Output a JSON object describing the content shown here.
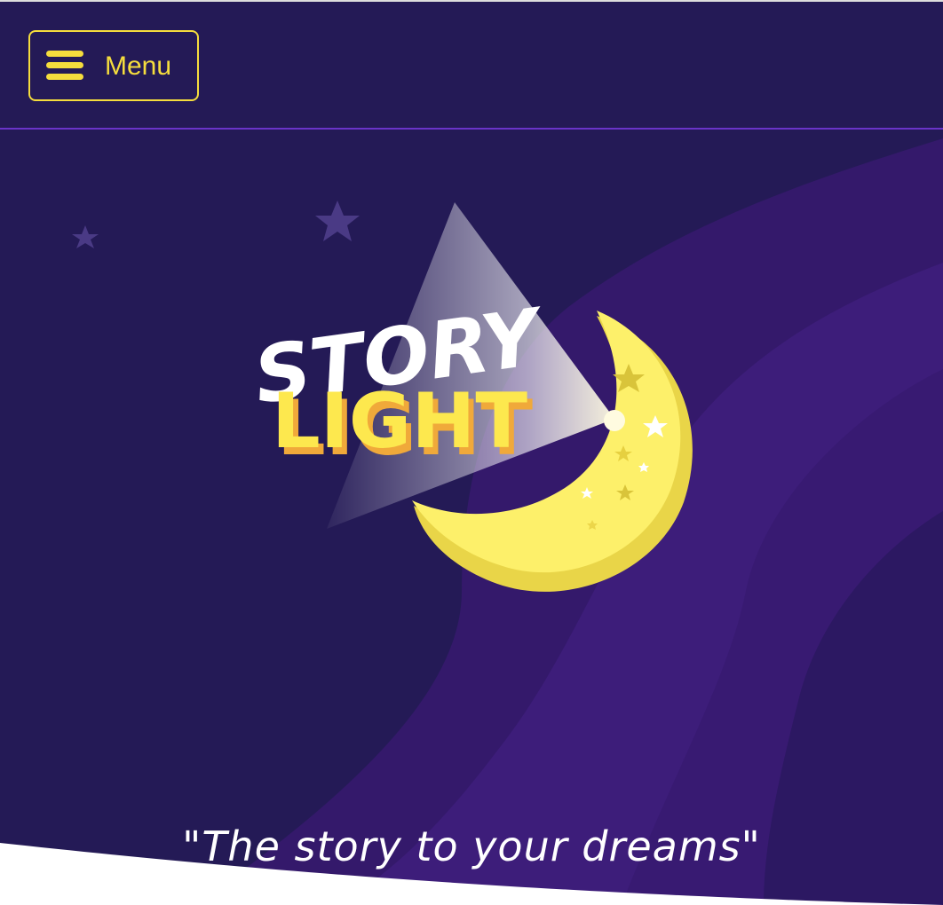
{
  "navbar": {
    "menu_label": "Menu",
    "menu_icon": "hamburger-icon"
  },
  "hero": {
    "logo": {
      "line1": "STORY",
      "line2": "LIGHT",
      "icon": "moon-icon"
    },
    "tagline": "\"The story to your dreams\""
  },
  "colors": {
    "background": "#241a56",
    "wave": "#3d1d7a",
    "accent_yellow": "#f5dd3d",
    "moon": "#fbe75c",
    "divider": "#6a34c9",
    "text_white": "#ffffff"
  }
}
